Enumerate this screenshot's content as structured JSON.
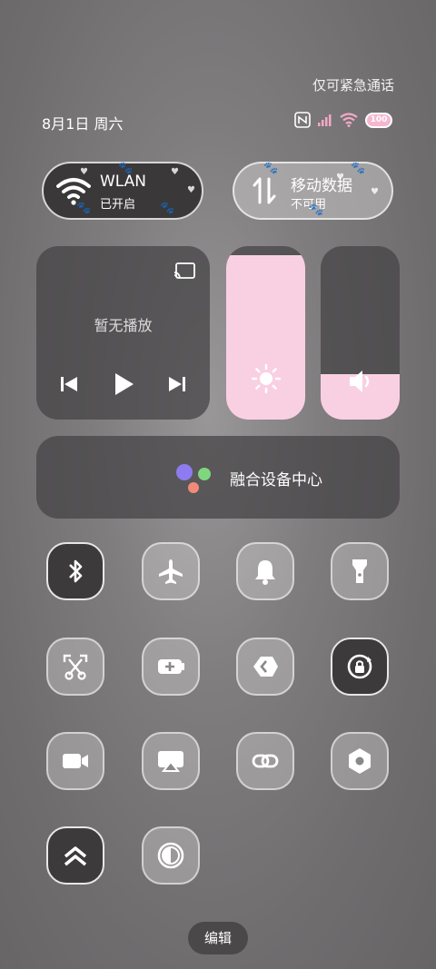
{
  "status_bar": {
    "emergency_text": "仅可紧急通话",
    "date": "8月1日 周六",
    "battery": "100"
  },
  "wlan": {
    "title": "WLAN",
    "status": "已开启",
    "active": true
  },
  "mobile_data": {
    "title": "移动数据",
    "status": "不可用",
    "active": false
  },
  "media": {
    "status": "暂无播放"
  },
  "brightness": {
    "level": 0.95
  },
  "volume": {
    "level": 0.26
  },
  "fusion": {
    "label": "融合设备中心"
  },
  "toggles": [
    {
      "name": "bluetooth",
      "active": true
    },
    {
      "name": "airplane-mode",
      "active": false
    },
    {
      "name": "sound-mode",
      "active": false
    },
    {
      "name": "flashlight",
      "active": false
    },
    {
      "name": "screenshot",
      "active": false
    },
    {
      "name": "battery-saver",
      "active": false
    },
    {
      "name": "nearby-share",
      "active": false
    },
    {
      "name": "auto-rotate-lock",
      "active": true
    },
    {
      "name": "screen-recorder",
      "active": false
    },
    {
      "name": "screen-cast",
      "active": false
    },
    {
      "name": "link",
      "active": false
    },
    {
      "name": "nfc-settings",
      "active": false
    },
    {
      "name": "performance-mode",
      "active": true
    },
    {
      "name": "dark-mode",
      "active": false
    }
  ],
  "edit_label": "编辑",
  "colors": {
    "accent_pink": "#f9d0e2",
    "dark_tile": "#3c3a3b"
  }
}
